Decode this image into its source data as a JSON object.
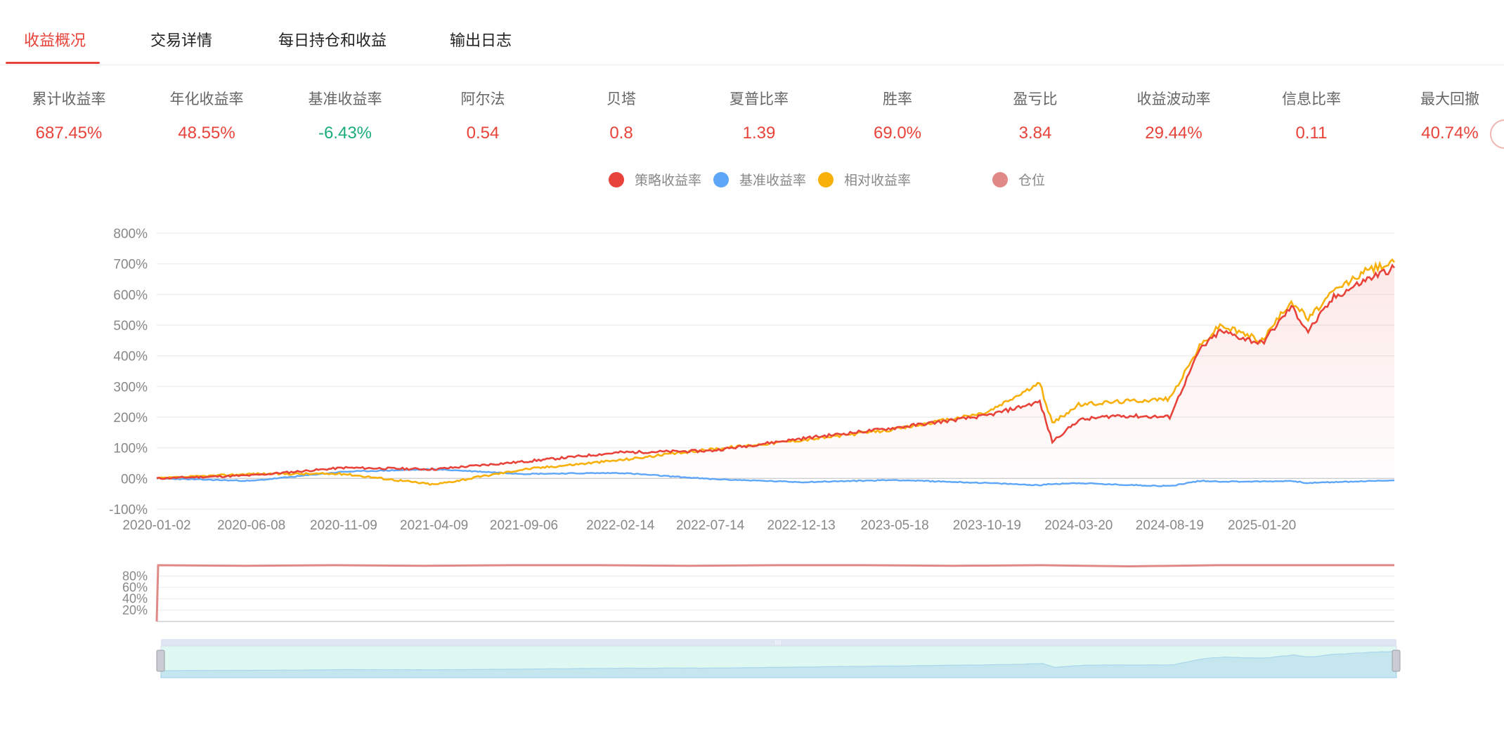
{
  "tabs": [
    {
      "label": "收益概况",
      "active": true
    },
    {
      "label": "交易详情",
      "active": false
    },
    {
      "label": "每日持仓和收益",
      "active": false
    },
    {
      "label": "输出日志",
      "active": false
    }
  ],
  "metrics": [
    {
      "label": "累计收益率",
      "value": "687.45%"
    },
    {
      "label": "年化收益率",
      "value": "48.55%"
    },
    {
      "label": "基准收益率",
      "value": "-6.43%"
    },
    {
      "label": "阿尔法",
      "value": "0.54"
    },
    {
      "label": "贝塔",
      "value": "0.8"
    },
    {
      "label": "夏普比率",
      "value": "1.39"
    },
    {
      "label": "胜率",
      "value": "69.0%"
    },
    {
      "label": "盈亏比",
      "value": "3.84"
    },
    {
      "label": "收益波动率",
      "value": "29.44%"
    },
    {
      "label": "信息比率",
      "value": "0.11"
    },
    {
      "label": "最大回撤",
      "value": "40.74%"
    }
  ],
  "colors": {
    "strategy": "#e8433a",
    "benchmark": "#5ea6f7",
    "relative": "#f8b00a",
    "position": "#e08a88",
    "active_tab": "#e8433a",
    "positive": "#e8433a",
    "negative": "#1aad78"
  },
  "chart_data": [
    {
      "type": "line",
      "legend_position": "top-center",
      "grid": true,
      "x_ticks": [
        "2020-01-02",
        "2020-06-08",
        "2020-11-09",
        "2021-04-09",
        "2021-09-06",
        "2022-02-14",
        "2022-07-14",
        "2022-12-13",
        "2023-05-18",
        "2023-10-19",
        "2024-03-20",
        "2024-08-19",
        "2025-01-20"
      ],
      "y_ticks": [
        "800%",
        "700%",
        "600%",
        "500%",
        "400%",
        "300%",
        "200%",
        "100%",
        "00%",
        "-100%"
      ],
      "ylim": [
        -100,
        800
      ],
      "x": [
        "2020-01-02",
        "2020-06-08",
        "2020-11-09",
        "2021-04-09",
        "2021-09-06",
        "2022-02-14",
        "2022-07-14",
        "2022-12-13",
        "2023-05-18",
        "2023-10-19",
        "2024-01-15",
        "2024-02-05",
        "2024-03-20",
        "2024-05-20",
        "2024-08-19",
        "2024-10-08",
        "2024-11-11",
        "2025-01-20",
        "2025-03-10",
        "2025-04-07",
        "2025-05-20",
        "2025-07-15",
        "2025-08-29"
      ],
      "series": [
        {
          "name": "策略收益率",
          "values": [
            0,
            10,
            35,
            30,
            55,
            85,
            90,
            130,
            165,
            205,
            250,
            120,
            190,
            205,
            200,
            420,
            480,
            440,
            560,
            480,
            590,
            650,
            687
          ]
        },
        {
          "name": "基准收益率",
          "values": [
            0,
            -8,
            22,
            30,
            15,
            18,
            -2,
            -12,
            -5,
            -15,
            -22,
            -18,
            -15,
            -20,
            -25,
            -8,
            -10,
            -10,
            -8,
            -15,
            -12,
            -9,
            -6
          ]
        },
        {
          "name": "相对收益率",
          "values": [
            0,
            15,
            15,
            -20,
            30,
            60,
            95,
            125,
            160,
            215,
            310,
            180,
            240,
            250,
            260,
            430,
            500,
            450,
            580,
            520,
            610,
            680,
            705
          ]
        }
      ]
    },
    {
      "type": "line",
      "grid": true,
      "y_ticks": [
        "80%",
        "60%",
        "40%",
        "20%"
      ],
      "ylim": [
        0,
        110
      ],
      "series": [
        {
          "name": "仓位",
          "values": [
            0,
            99,
            98,
            99,
            98,
            99,
            99,
            98,
            99,
            99,
            98,
            99,
            97,
            99,
            99,
            99
          ]
        }
      ]
    }
  ]
}
